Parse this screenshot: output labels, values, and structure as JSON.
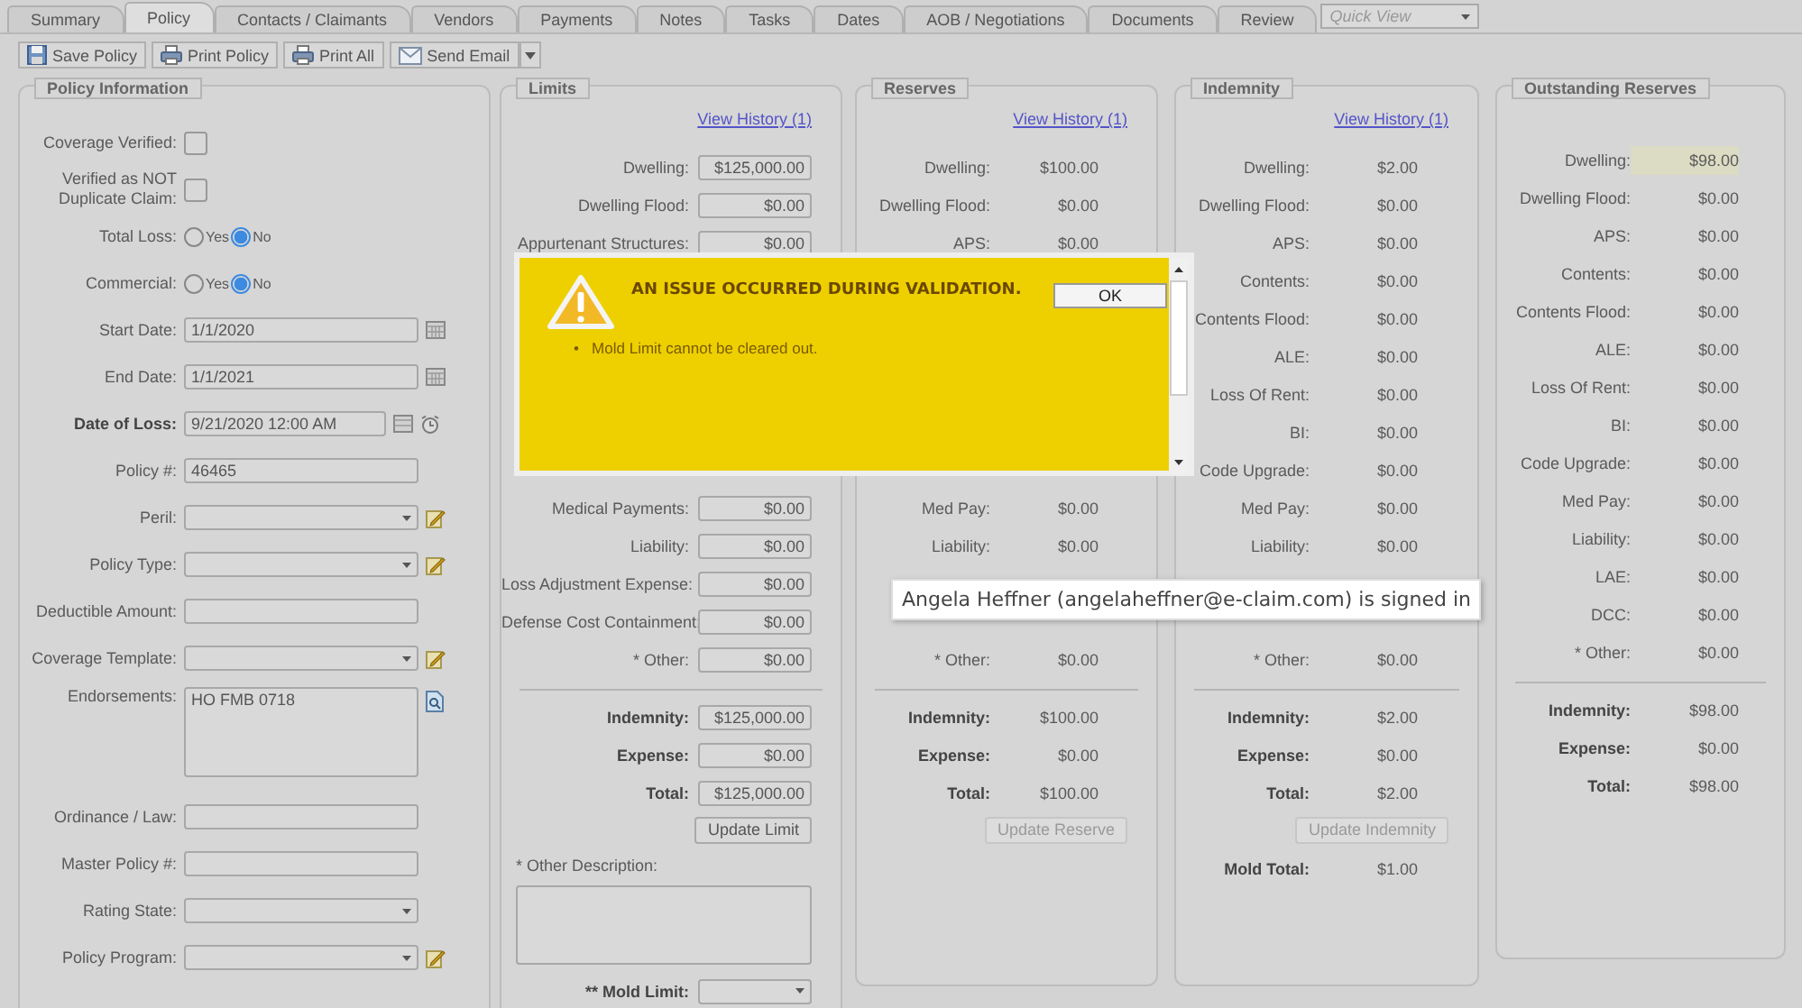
{
  "tabs": [
    {
      "label": "Summary",
      "selected": false
    },
    {
      "label": "Policy",
      "selected": true
    },
    {
      "label": "Contacts / Claimants",
      "selected": false
    },
    {
      "label": "Vendors",
      "selected": false
    },
    {
      "label": "Payments",
      "selected": false
    },
    {
      "label": "Notes",
      "selected": false
    },
    {
      "label": "Tasks",
      "selected": false
    },
    {
      "label": "Dates",
      "selected": false
    },
    {
      "label": "AOB / Negotiations",
      "selected": false
    },
    {
      "label": "Documents",
      "selected": false
    },
    {
      "label": "Review",
      "selected": false
    }
  ],
  "quick_view": {
    "placeholder": "Quick View"
  },
  "toolbar": [
    {
      "label": "Save Policy",
      "kind": "button"
    },
    {
      "label": "Print Policy",
      "kind": "button"
    },
    {
      "label": "Print All",
      "kind": "button"
    },
    {
      "label": "Send Email",
      "kind": "split"
    }
  ],
  "policy_information": {
    "title": "Policy Information",
    "fields": [
      {
        "label": "Coverage Verified:",
        "kind": "checkbox",
        "checked": false,
        "bold": false
      },
      {
        "label": "Verified as NOT Duplicate Claim:",
        "kind": "checkbox",
        "checked": false,
        "bold": false
      },
      {
        "label": "Total Loss:",
        "kind": "radio",
        "bold": false,
        "options": [
          {
            "label": "Yes",
            "selected": false
          },
          {
            "label": "No",
            "selected": true
          }
        ]
      },
      {
        "label": "Commercial:",
        "kind": "radio",
        "bold": false,
        "options": [
          {
            "label": "Yes",
            "selected": false
          },
          {
            "label": "No",
            "selected": true
          }
        ]
      },
      {
        "label": "Start Date:",
        "kind": "date",
        "value": "1/1/2020",
        "bold": false
      },
      {
        "label": "End Date:",
        "kind": "date",
        "value": "1/1/2021",
        "bold": false
      },
      {
        "label": "Date of Loss:",
        "kind": "datetime",
        "value": "9/21/2020 12:00 AM",
        "bold": true
      },
      {
        "label": "Policy #:",
        "kind": "text",
        "value": "46465",
        "bold": false
      },
      {
        "label": "Peril:",
        "kind": "select_edit",
        "bold": false
      },
      {
        "label": "Policy Type:",
        "kind": "select_edit",
        "bold": false
      },
      {
        "label": "Deductible Amount:",
        "kind": "text",
        "bold": false
      },
      {
        "label": "Coverage Template:",
        "kind": "select_edit",
        "bold": false
      },
      {
        "label": "Endorsements:",
        "kind": "textarea",
        "value": "HO FMB 0718",
        "bold": false
      },
      {
        "label": "Ordinance / Law:",
        "kind": "text",
        "bold": false
      },
      {
        "label": "Master Policy #:",
        "kind": "text",
        "bold": false
      },
      {
        "label": "Rating State:",
        "kind": "select",
        "bold": false
      },
      {
        "label": "Policy Program:",
        "kind": "select_edit",
        "bold": false
      }
    ]
  },
  "limits": {
    "title": "Limits",
    "view_history": "View History (1)",
    "rows": [
      {
        "label": "Dwelling:",
        "value": "$125,000.00"
      },
      {
        "label": "Dwelling Flood:",
        "value": "$0.00"
      },
      {
        "label": "Appurtenant Structures:",
        "value": "$0.00"
      },
      {
        "label": "Medical Payments:",
        "value": "$0.00"
      },
      {
        "label": "Liability:",
        "value": "$0.00"
      },
      {
        "label": "Loss Adjustment Expense:",
        "value": "$0.00"
      },
      {
        "label": "Defense Cost Containment:",
        "value": "$0.00"
      },
      {
        "label": "* Other:",
        "value": "$0.00"
      }
    ],
    "totals": [
      {
        "label": "Indemnity:",
        "value": "$125,000.00"
      },
      {
        "label": "Expense:",
        "value": "$0.00"
      },
      {
        "label": "Total:",
        "value": "$125,000.00"
      }
    ],
    "update_button": {
      "label": "Update Limit",
      "disabled": false
    },
    "other_description": {
      "label": "* Other Description:"
    },
    "mold_limit": {
      "label": "** Mold Limit:"
    }
  },
  "reserves": {
    "title": "Reserves",
    "view_history": "View History (1)",
    "rows": [
      {
        "label": "Dwelling:",
        "value": "$100.00",
        "highlighted": false
      },
      {
        "label": "Dwelling Flood:",
        "value": "$0.00",
        "highlighted": false
      },
      {
        "label": "APS:",
        "value": "$0.00",
        "highlighted": false
      },
      {
        "label": "Med Pay:",
        "value": "$0.00",
        "highlighted": false
      },
      {
        "label": "Liability:",
        "value": "$0.00",
        "highlighted": false
      },
      {
        "label": "* Other:",
        "value": "$0.00",
        "highlighted": false
      }
    ],
    "totals": [
      {
        "label": "Indemnity:",
        "value": "$100.00"
      },
      {
        "label": "Expense:",
        "value": "$0.00"
      },
      {
        "label": "Total:",
        "value": "$100.00"
      }
    ],
    "update_button": {
      "label": "Update Reserve",
      "disabled": true
    }
  },
  "indemnity": {
    "title": "Indemnity",
    "view_history": "View History (1)",
    "rows": [
      {
        "label": "Dwelling:",
        "value": "$2.00",
        "highlighted": false
      },
      {
        "label": "Dwelling Flood:",
        "value": "$0.00",
        "highlighted": false
      },
      {
        "label": "APS:",
        "value": "$0.00",
        "highlighted": false
      },
      {
        "label": "Contents:",
        "value": "$0.00",
        "highlighted": false
      },
      {
        "label": "Contents Flood:",
        "value": "$0.00",
        "highlighted": false
      },
      {
        "label": "ALE:",
        "value": "$0.00",
        "highlighted": false
      },
      {
        "label": "Loss Of Rent:",
        "value": "$0.00",
        "highlighted": false
      },
      {
        "label": "BI:",
        "value": "$0.00",
        "highlighted": false
      },
      {
        "label": "Code Upgrade:",
        "value": "$0.00",
        "highlighted": false
      },
      {
        "label": "Med Pay:",
        "value": "$0.00",
        "highlighted": false
      },
      {
        "label": "Liability:",
        "value": "$0.00",
        "highlighted": false
      },
      {
        "label": "* Other:",
        "value": "$0.00",
        "highlighted": false
      }
    ],
    "totals": [
      {
        "label": "Indemnity:",
        "value": "$2.00"
      },
      {
        "label": "Expense:",
        "value": "$0.00"
      },
      {
        "label": "Total:",
        "value": "$2.00"
      }
    ],
    "update_button": {
      "label": "Update Indemnity",
      "disabled": true
    },
    "mold_total": {
      "label": "Mold Total:",
      "value": "$1.00"
    }
  },
  "outstanding_reserves": {
    "title": "Outstanding Reserves",
    "rows": [
      {
        "label": "Dwelling:",
        "value": "$98.00",
        "highlighted": true
      },
      {
        "label": "Dwelling Flood:",
        "value": "$0.00",
        "highlighted": false
      },
      {
        "label": "APS:",
        "value": "$0.00",
        "highlighted": false
      },
      {
        "label": "Contents:",
        "value": "$0.00",
        "highlighted": false
      },
      {
        "label": "Contents Flood:",
        "value": "$0.00",
        "highlighted": false
      },
      {
        "label": "ALE:",
        "value": "$0.00",
        "highlighted": false
      },
      {
        "label": "Loss Of Rent:",
        "value": "$0.00",
        "highlighted": false
      },
      {
        "label": "BI:",
        "value": "$0.00",
        "highlighted": false
      },
      {
        "label": "Code Upgrade:",
        "value": "$0.00",
        "highlighted": false
      },
      {
        "label": "Med Pay:",
        "value": "$0.00",
        "highlighted": false
      },
      {
        "label": "Liability:",
        "value": "$0.00",
        "highlighted": false
      },
      {
        "label": "LAE:",
        "value": "$0.00",
        "highlighted": false
      },
      {
        "label": "DCC:",
        "value": "$0.00",
        "highlighted": false
      },
      {
        "label": "* Other:",
        "value": "$0.00",
        "highlighted": false
      }
    ],
    "totals": [
      {
        "label": "Indemnity:",
        "value": "$98.00"
      },
      {
        "label": "Expense:",
        "value": "$0.00"
      },
      {
        "label": "Total:",
        "value": "$98.00"
      }
    ]
  },
  "dialog": {
    "title": "AN ISSUE OCCURRED DURING VALIDATION.",
    "button": "OK",
    "messages": [
      {
        "marker": "•",
        "text": "Mold Limit cannot be cleared out."
      }
    ]
  },
  "tooltip": {
    "text": "Angela Heffner (angelaheffner@e-claim.com) is signed in"
  }
}
